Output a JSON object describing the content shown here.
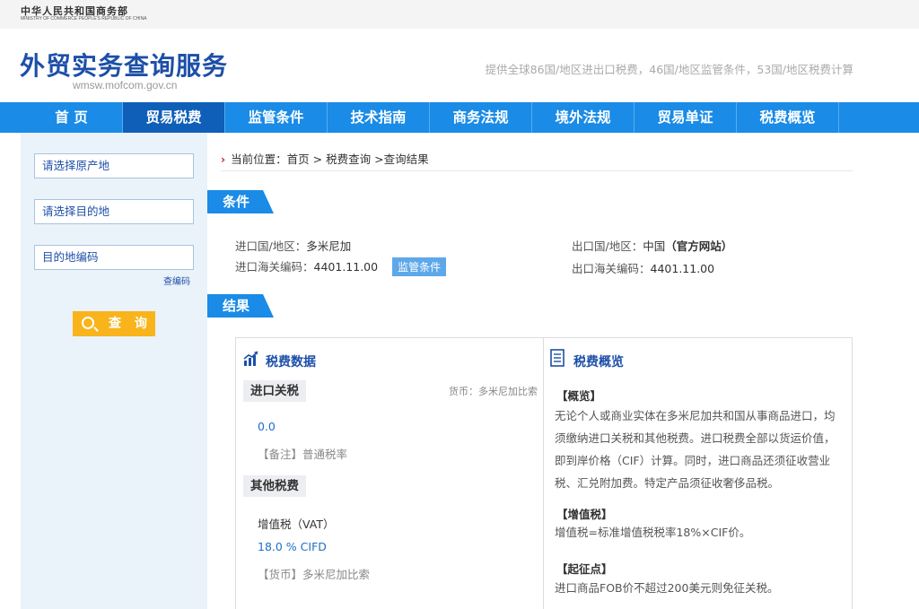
{
  "header": {
    "ministry_zh": "中华人民共和国商务部",
    "ministry_en": "MINISTRY OF COMMERCE PEOPLE'S REPUBLIC OF CHINA",
    "title": "外贸实务查询服务",
    "url": "wmsw.mofcom.gov.cn",
    "slogan": "提供全球86国/地区进出口税费，46国/地区监管条件，53国/地区税费计算"
  },
  "nav": {
    "items": [
      "首 页",
      "贸易税费",
      "监管条件",
      "技术指南",
      "商务法规",
      "境外法规",
      "贸易单证",
      "税费概览"
    ],
    "active_index": 1
  },
  "sidebar": {
    "origin_placeholder": "请选择原产地",
    "destination_placeholder": "请选择目的地",
    "code_placeholder": "目的地编码",
    "lookup_link": "查编码",
    "search_button": "查 询"
  },
  "breadcrumb": {
    "prefix": "当前位置：",
    "home": "首页",
    "sep": ">",
    "level2": "税费查询",
    "level3": ">查询结果"
  },
  "conditions": {
    "ribbon": "条件",
    "import_country_label": "进口国/地区：",
    "import_country": "多米尼加",
    "import_code_label": "进口海关编码：",
    "import_code": "4401.11.00",
    "regulation_badge": "监管条件",
    "export_country_label": "出口国/地区：",
    "export_country": "中国",
    "official_site": "（官方网站）",
    "export_code_label": "出口海关编码：",
    "export_code": "4401.11.00"
  },
  "results": {
    "ribbon": "结果",
    "tax_data_title": "税费数据",
    "import_duty_tab": "进口关税",
    "currency_note": "货币：多米尼加比索",
    "import_duty_value": "0.0",
    "import_duty_note": "【备注】普通税率",
    "other_taxes_tab": "其他税费",
    "vat_label": "增值税（VAT）",
    "vat_value": "18.0 % CIFD",
    "vat_currency": "【货币】多米尼加比索"
  },
  "overview": {
    "title": "税费概览",
    "summary_head": "【概览】",
    "summary_lines": [
      "无论个人或商业实体在多米尼加共和国从事商品进口，均",
      "须缴纳进口关税和其他税费。进口税费全部以货运价值，",
      "即到岸价格（CIF）计算。同时，进口商品还须征收营业",
      "税、汇兑附加费。特定产品须征收奢侈品税。"
    ],
    "vat_head": "【增值税】",
    "vat_text": "增值税=标准增值税税率18%×CIF价。",
    "threshold_head": "【起征点】",
    "threshold_text": "进口商品FOB价不超过200美元则免征关税。"
  },
  "colors": {
    "brand_blue": "#1d4fa8",
    "nav_blue": "#1a8be6",
    "nav_active": "#0f5fb8",
    "search_orange": "#f9b41b"
  }
}
